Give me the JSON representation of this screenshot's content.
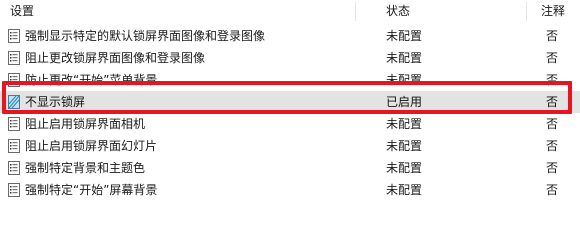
{
  "table": {
    "headers": {
      "setting": "设置",
      "status": "状态",
      "comment": "注释"
    },
    "rows": [
      {
        "name": "强制显示特定的默认锁屏界面图像和登录图像",
        "status": "未配置",
        "comment": "否",
        "icon": "policy-document-icon",
        "selected": false
      },
      {
        "name": "阻止更改锁屏界面图像和登录图像",
        "status": "未配置",
        "comment": "否",
        "icon": "policy-document-icon",
        "selected": false
      },
      {
        "name": "防止更改“开始”菜单背景",
        "status": "未配置",
        "comment": "否",
        "icon": "policy-document-icon",
        "selected": false
      },
      {
        "name": "不显示锁屏",
        "status": "已启用",
        "comment": "否",
        "icon": "policy-enabled-icon",
        "selected": true
      },
      {
        "name": "阻止启用锁屏界面相机",
        "status": "未配置",
        "comment": "否",
        "icon": "policy-document-icon",
        "selected": false
      },
      {
        "name": "阻止启用锁屏界面幻灯片",
        "status": "未配置",
        "comment": "否",
        "icon": "policy-document-icon",
        "selected": false
      },
      {
        "name": "强制特定背景和主题色",
        "status": "未配置",
        "comment": "否",
        "icon": "policy-document-icon",
        "selected": false
      },
      {
        "name": "强制特定“开始”屏幕背景",
        "status": "未配置",
        "comment": "否",
        "icon": "policy-document-icon",
        "selected": false
      }
    ]
  },
  "colors": {
    "highlight": "#e8141f",
    "selected_row": "#e3e3e3"
  }
}
